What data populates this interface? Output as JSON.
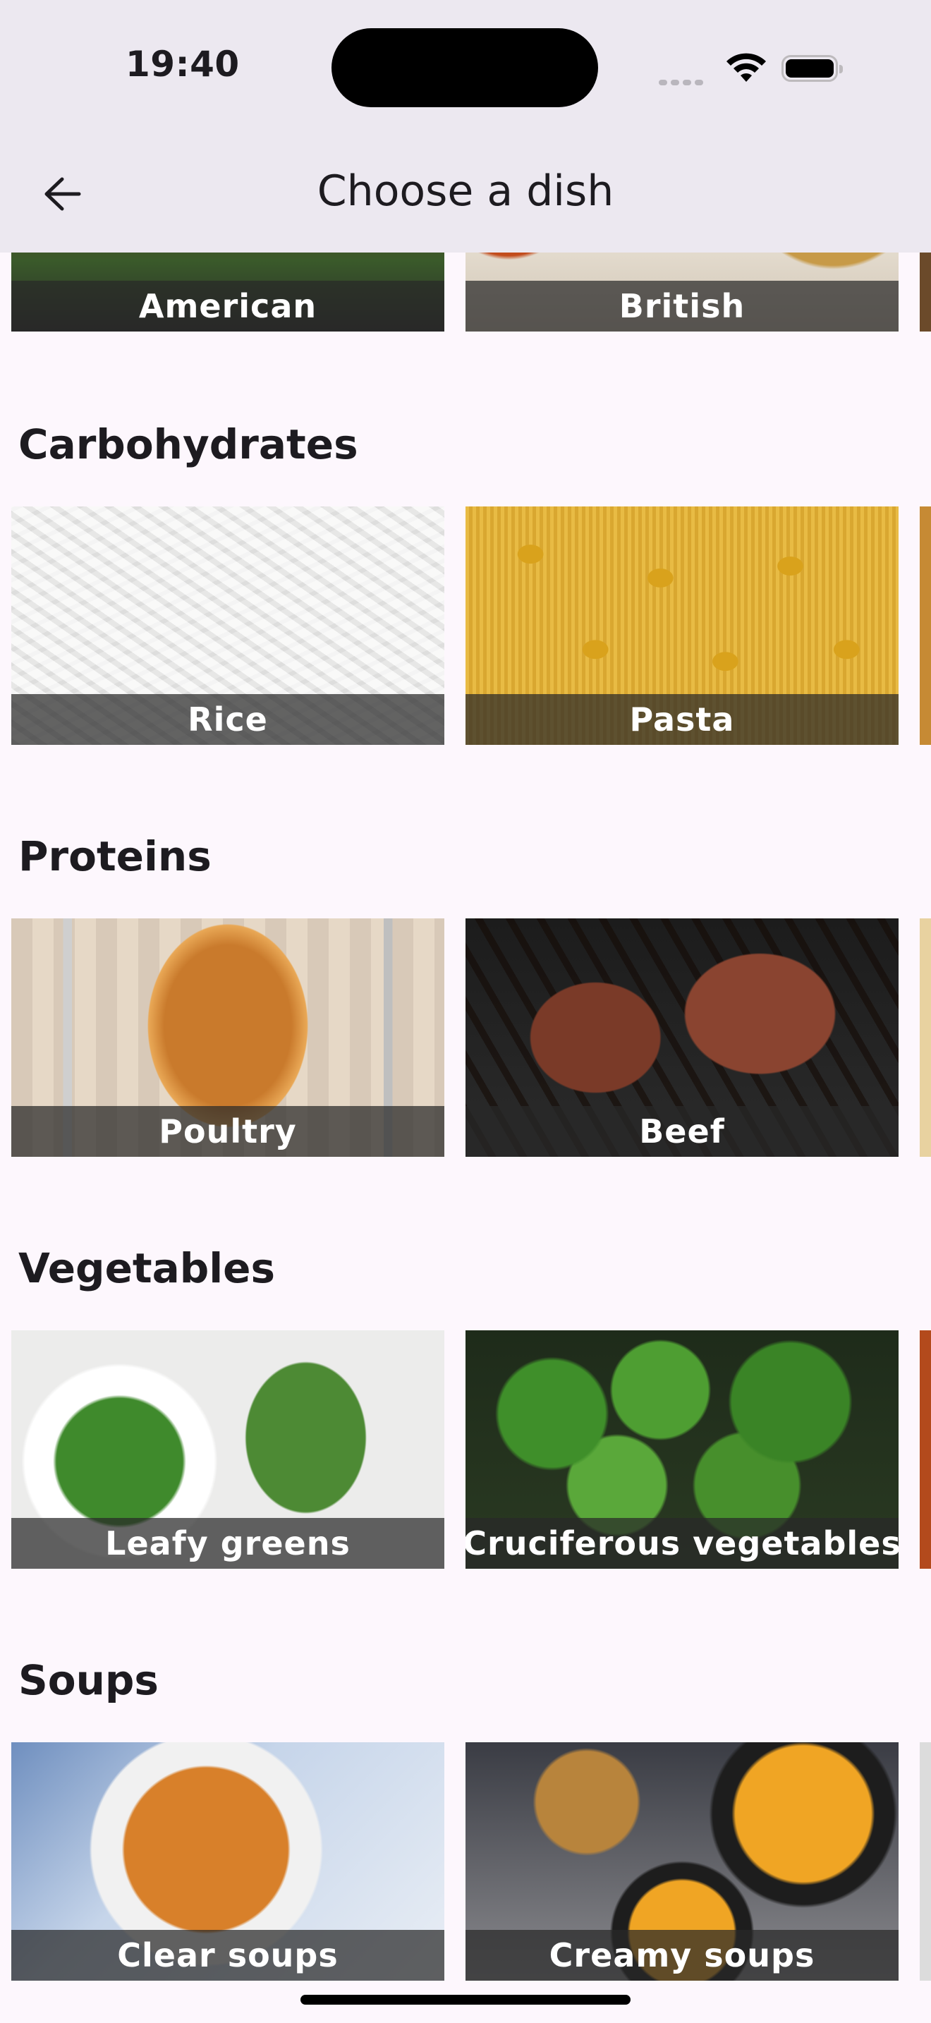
{
  "status_bar": {
    "time": "19:40"
  },
  "header": {
    "title": "Choose a dish"
  },
  "icons": {
    "back": "arrow-left-icon",
    "wifi": "wifi-icon",
    "battery": "battery-icon",
    "signal": "cellular-signal-icon"
  },
  "top_row": [
    {
      "label": "American",
      "image": "burgers"
    },
    {
      "label": "British",
      "image": "british-food"
    }
  ],
  "sections": [
    {
      "title": "Carbohydrates",
      "items": [
        {
          "label": "Rice",
          "image": "rice"
        },
        {
          "label": "Pasta",
          "image": "pasta"
        }
      ]
    },
    {
      "title": "Proteins",
      "items": [
        {
          "label": "Poultry",
          "image": "roast-chicken"
        },
        {
          "label": "Beef",
          "image": "steaks"
        }
      ]
    },
    {
      "title": "Vegetables",
      "items": [
        {
          "label": "Leafy greens",
          "image": "lettuce"
        },
        {
          "label": "Cruciferous vegetables",
          "image": "broccoli"
        }
      ]
    },
    {
      "title": "Soups",
      "items": [
        {
          "label": "Clear soups",
          "image": "vegetable-broth"
        },
        {
          "label": "Creamy soups",
          "image": "pumpkin-soup"
        }
      ]
    }
  ]
}
